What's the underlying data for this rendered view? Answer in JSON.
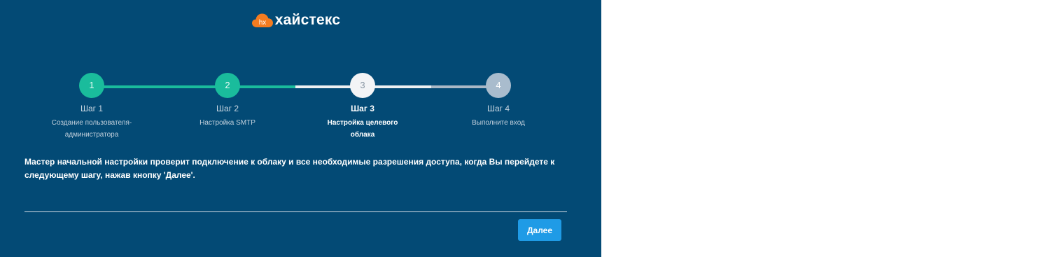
{
  "brand": {
    "icon_text": "hx",
    "name": "хайстекс",
    "color": "#f47c20"
  },
  "colors": {
    "background": "#034a75",
    "done": "#1abc9c",
    "active": "#f3f4f6",
    "pending": "#a9bccd",
    "button": "#1f9be6"
  },
  "steps": [
    {
      "number": "1",
      "title": "Шаг 1",
      "subtitle": "Создание пользователя-администратора",
      "state": "done"
    },
    {
      "number": "2",
      "title": "Шаг 2",
      "subtitle": "Настройка SMTP",
      "state": "done"
    },
    {
      "number": "3",
      "title": "Шаг 3",
      "subtitle": "Настройка целевого облака",
      "state": "active"
    },
    {
      "number": "4",
      "title": "Шаг 4",
      "subtitle": "Выполните вход",
      "state": "pending"
    }
  ],
  "message": "Мастер начальной настройки проверит подключение к облаку и все необходимые разрешения доступа, когда Вы перейдете к следующему шагу, нажав кнопку 'Далее'.",
  "actions": {
    "next_label": "Далее"
  }
}
